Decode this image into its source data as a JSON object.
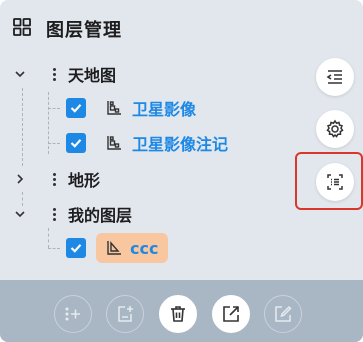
{
  "panel": {
    "title": "图层管理"
  },
  "tree": {
    "groups": [
      {
        "label": "天地图",
        "expanded": true,
        "layers": [
          {
            "label": "卫星影像",
            "checked": true
          },
          {
            "label": "卫星影像注记",
            "checked": true
          }
        ]
      },
      {
        "label": "地形",
        "expanded": false,
        "layers": []
      },
      {
        "label": "我的图层",
        "expanded": true,
        "layers": [
          {
            "label": "ccc",
            "checked": true
          }
        ]
      }
    ]
  },
  "side_buttons": [
    {
      "icon": "collapse-list-icon",
      "highlighted": false
    },
    {
      "icon": "gear-icon",
      "highlighted": false
    },
    {
      "icon": "scan-list-icon",
      "highlighted": true
    }
  ],
  "toolbar": {
    "buttons": [
      {
        "icon": "add-layer-icon",
        "enabled": false
      },
      {
        "icon": "add-group-icon",
        "enabled": false
      },
      {
        "icon": "trash-icon",
        "enabled": true
      },
      {
        "icon": "export-icon",
        "enabled": true
      },
      {
        "icon": "edit-icon",
        "enabled": false
      }
    ]
  },
  "colors": {
    "accent": "#1e88e5",
    "panel_bg": "#e2e7ed",
    "toolbar_bg": "#a9b6c4",
    "selected_chip": "#f9c79f",
    "highlight_border": "#d9372b"
  }
}
